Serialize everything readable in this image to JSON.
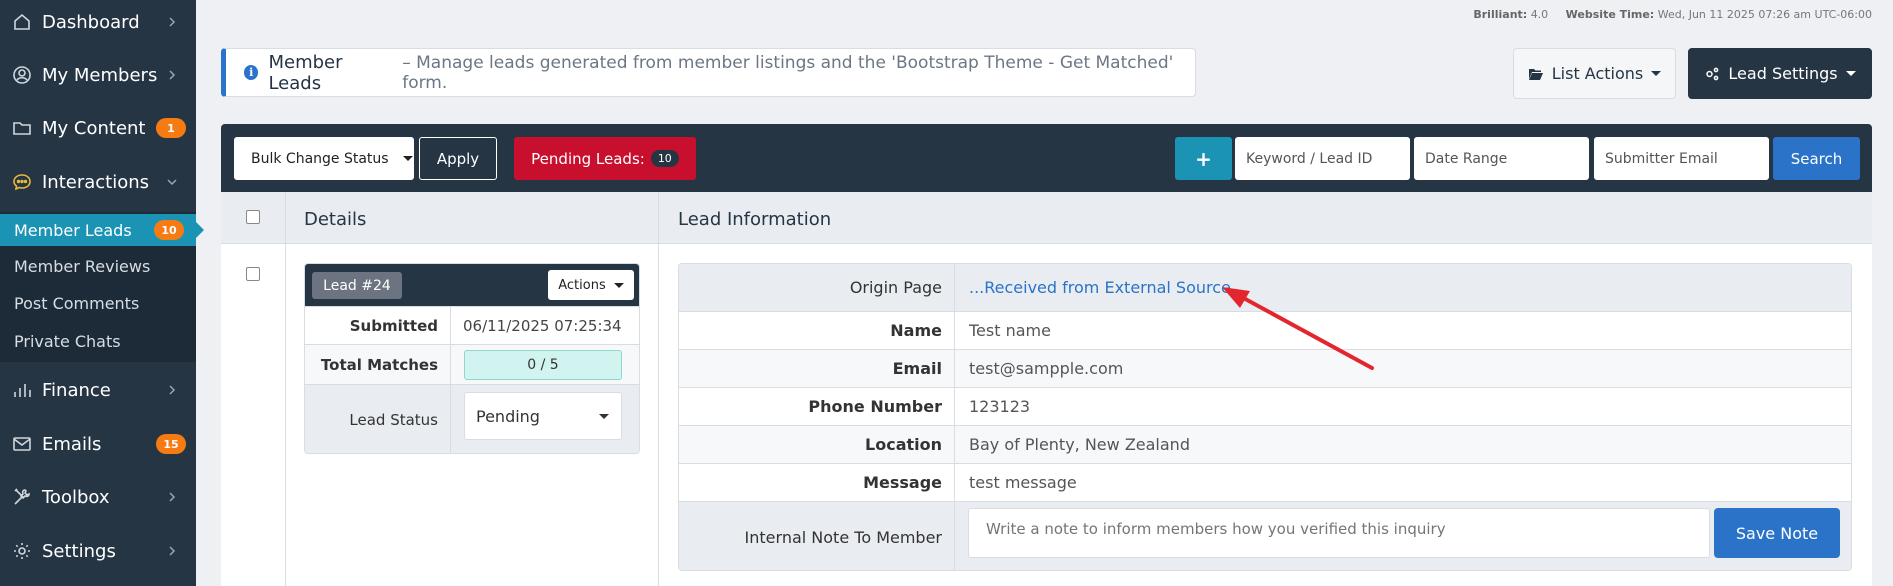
{
  "sidebar": {
    "items": [
      {
        "label": "Dashboard",
        "icon": "home-icon"
      },
      {
        "label": "My Members",
        "icon": "user-icon"
      },
      {
        "label": "My Content",
        "icon": "folder-icon",
        "badge": "1"
      },
      {
        "label": "Interactions",
        "icon": "chat-icon"
      },
      {
        "label": "Finance",
        "icon": "bar-chart-icon"
      },
      {
        "label": "Emails",
        "icon": "envelope-icon",
        "badge": "15"
      },
      {
        "label": "Toolbox",
        "icon": "tools-icon"
      },
      {
        "label": "Settings",
        "icon": "gear-icon"
      }
    ],
    "subitems": [
      {
        "label": "Member Leads",
        "badge": "10",
        "active": true
      },
      {
        "label": "Member Reviews"
      },
      {
        "label": "Post Comments"
      },
      {
        "label": "Private Chats"
      }
    ]
  },
  "topinfo": {
    "brilliant_label": "Brilliant:",
    "brilliant_value": "4.0",
    "time_label": "Website Time:",
    "time_value": "Wed, Jun 11 2025 07:26 am UTC-06:00"
  },
  "header": {
    "title": "Member Leads",
    "description": "– Manage leads generated from member listings and the 'Bootstrap Theme - Get Matched' form.",
    "list_actions": "List Actions",
    "lead_settings": "Lead Settings"
  },
  "toolbar": {
    "bulk_change": "Bulk Change Status",
    "apply": "Apply",
    "pending_label": "Pending Leads:",
    "pending_count": "10",
    "plus": "+",
    "keyword_placeholder": "Keyword / Lead ID",
    "date_placeholder": "Date Range",
    "email_placeholder": "Submitter Email",
    "search": "Search"
  },
  "table": {
    "col_details": "Details",
    "col_info": "Lead Information"
  },
  "lead": {
    "number": "Lead #24",
    "actions": "Actions",
    "submitted_label": "Submitted",
    "submitted_value": "06/11/2025 07:25:34",
    "matches_label": "Total Matches",
    "matches_value": "0 / 5",
    "status_label": "Lead Status",
    "status_value": "Pending"
  },
  "info": {
    "origin_label": "Origin Page",
    "origin_value": "...Received from External Source",
    "name_label": "Name",
    "name_value": "Test name",
    "email_label": "Email",
    "email_value": "test@sampple.com",
    "phone_label": "Phone Number",
    "phone_value": "123123",
    "location_label": "Location",
    "location_value": "Bay of Plenty, New Zealand",
    "message_label": "Message",
    "message_value": "test message",
    "note_label": "Internal Note To Member",
    "note_placeholder": "Write a note to inform members how you verified this inquiry",
    "save_note": "Save Note"
  },
  "colors": {
    "sidebar_bg": "#263544",
    "accent_blue": "#2a73c9",
    "teal": "#1a93b4",
    "badge_orange": "#f57b12",
    "pending_red": "#c8102e",
    "annotation_arrow": "#e3262e"
  }
}
